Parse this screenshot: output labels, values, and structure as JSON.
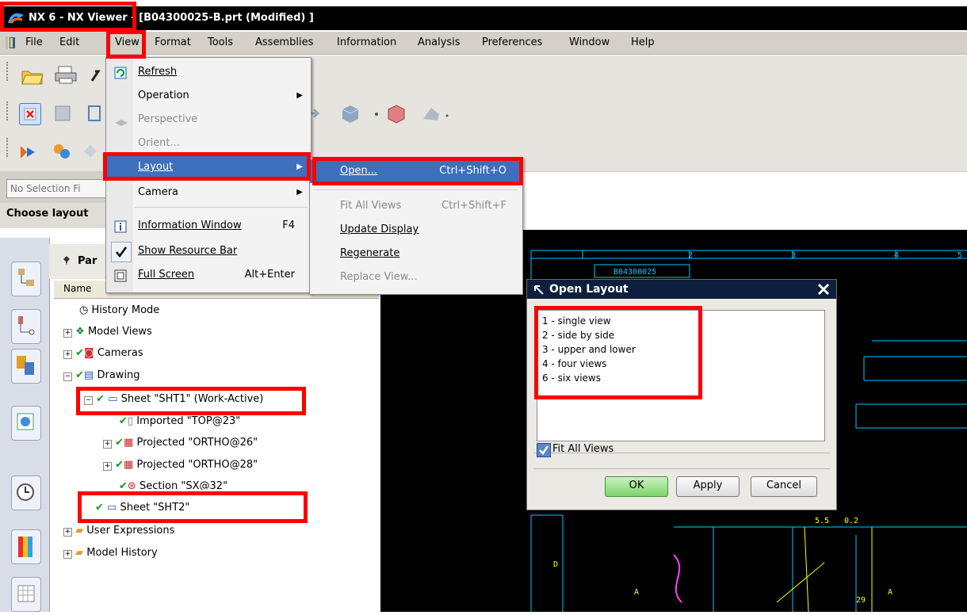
{
  "window": {
    "title": "NX 6 - NX Viewer - [B04300025-B.prt (Modified) ]"
  },
  "menubar": {
    "items": [
      "File",
      "Edit",
      "View",
      "Format",
      "Tools",
      "Assemblies",
      "Information",
      "Analysis",
      "Preferences",
      "Window",
      "Help"
    ]
  },
  "selection_filter": {
    "placeholder": "No Selection Fi"
  },
  "cue": {
    "text": "Choose layout"
  },
  "view_menu": {
    "items": [
      {
        "label": "Refresh",
        "shortcut": "",
        "disabled": false,
        "submenu": false
      },
      {
        "label": "Operation",
        "shortcut": "",
        "disabled": false,
        "submenu": true
      },
      {
        "label": "Perspective",
        "shortcut": "",
        "disabled": true,
        "submenu": false
      },
      {
        "label": "Orient...",
        "shortcut": "",
        "disabled": true,
        "submenu": false
      },
      {
        "label": "Layout",
        "shortcut": "",
        "disabled": false,
        "submenu": true,
        "selected": true
      },
      {
        "label": "Camera",
        "shortcut": "",
        "disabled": false,
        "submenu": true
      },
      {
        "label": "Information Window",
        "shortcut": "F4",
        "disabled": false,
        "submenu": false
      },
      {
        "label": "Show Resource Bar",
        "shortcut": "",
        "disabled": false,
        "submenu": false,
        "checked": true
      },
      {
        "label": "Full Screen",
        "shortcut": "Alt+Enter",
        "disabled": false,
        "submenu": false
      }
    ]
  },
  "layout_menu": {
    "items": [
      {
        "label": "Open...",
        "shortcut": "Ctrl+Shift+O",
        "disabled": false,
        "selected": true
      },
      {
        "label": "Fit All Views",
        "shortcut": "Ctrl+Shift+F",
        "disabled": true
      },
      {
        "label": "Update Display",
        "shortcut": "",
        "disabled": false
      },
      {
        "label": "Regenerate",
        "shortcut": "",
        "disabled": false
      },
      {
        "label": "Replace View...",
        "shortcut": "",
        "disabled": true
      }
    ]
  },
  "navigator": {
    "header": "Par",
    "column_name": "Name",
    "tree": [
      {
        "label": "History Mode"
      },
      {
        "label": "Model Views"
      },
      {
        "label": "Cameras"
      },
      {
        "label": "Drawing"
      },
      {
        "label": "Sheet \"SHT1\" (Work-Active)"
      },
      {
        "label": "Imported \"TOP@23\""
      },
      {
        "label": "Projected \"ORTHO@26\""
      },
      {
        "label": "Projected \"ORTHO@28\""
      },
      {
        "label": "Section \"SX@32\""
      },
      {
        "label": "Sheet \"SHT2\""
      },
      {
        "label": "User Expressions"
      },
      {
        "label": "Model History"
      }
    ]
  },
  "dialog": {
    "title": "Open Layout",
    "options": [
      "1 - single view",
      "2 - side by side",
      "3 - upper and lower",
      "4 - four views",
      "6 - six views"
    ],
    "fit_all_views_label": "Fit All Views",
    "fit_all_views_checked": true,
    "ok_label": "OK",
    "apply_label": "Apply",
    "cancel_label": "Cancel"
  },
  "drawing": {
    "border_numbers": [
      "2",
      "3",
      "4",
      "5"
    ],
    "title_block_mirror": "B04300025",
    "dims": [
      "5.5",
      "0.2",
      "29",
      "A",
      "A",
      "D"
    ]
  },
  "colors": {
    "highlight": "#ff0000",
    "menu_selection": "#3d6fbd",
    "check_green": "#1a9a1a",
    "drawing_line": "#00c8ff",
    "drawing_dim": "#ffff00"
  }
}
